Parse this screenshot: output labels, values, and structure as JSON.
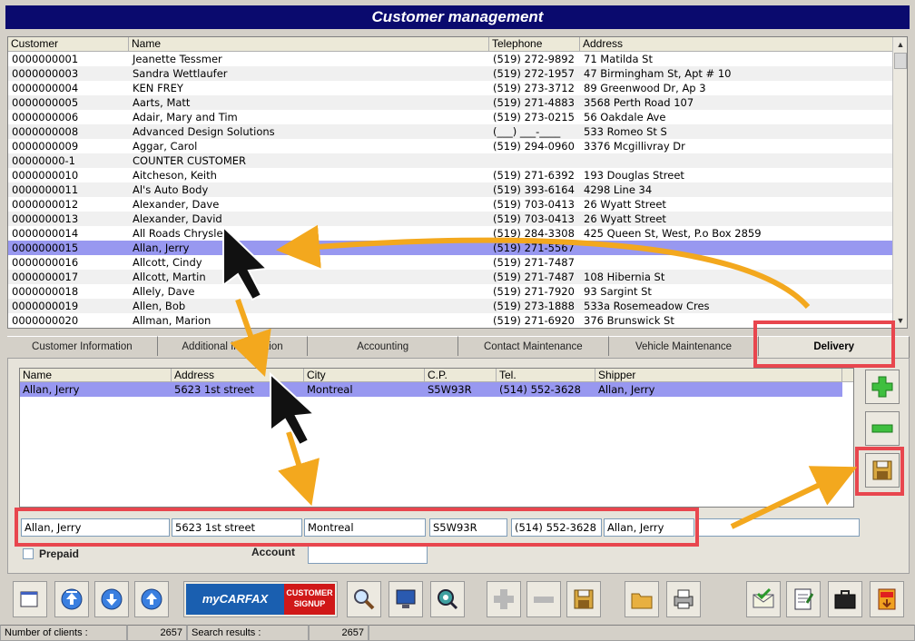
{
  "window": {
    "title": "Customer management"
  },
  "grid": {
    "headers": [
      "Customer",
      "Name",
      "Telephone",
      "Address"
    ],
    "rows": [
      [
        "0000000001",
        "Jeanette Tessmer",
        "(519) 272-9892",
        "71 Matilda St"
      ],
      [
        "0000000003",
        "Sandra Wettlaufer",
        "(519) 272-1957",
        "47 Birmingham St, Apt # 10"
      ],
      [
        "0000000004",
        " KEN FREY",
        "(519) 273-3712",
        "89 Greenwood Dr, Ap 3"
      ],
      [
        "0000000005",
        "Aarts, Matt",
        "(519) 271-4883",
        "3568 Perth Road 107"
      ],
      [
        "0000000006",
        "Adair, Mary and Tim",
        "(519) 273-0215",
        "56 Oakdale Ave"
      ],
      [
        "0000000008",
        "Advanced Design Solutions",
        "(___) ___-____",
        "533 Romeo St S"
      ],
      [
        "0000000009",
        "Aggar, Carol",
        "(519) 294-0960",
        "3376 Mcgillivray Dr"
      ],
      [
        "00000000-1",
        "COUNTER CUSTOMER",
        "",
        ""
      ],
      [
        "0000000010",
        "Aitcheson, Keith",
        "(519) 271-6392",
        "193 Douglas Street"
      ],
      [
        "0000000011",
        "Al's Auto Body",
        "(519) 393-6164",
        "4298 Line 34"
      ],
      [
        "0000000012",
        "Alexander, Dave",
        "(519) 703-0413",
        "26 Wyatt Street"
      ],
      [
        "0000000013",
        "Alexander, David",
        "(519) 703-0413",
        "26 Wyatt Street"
      ],
      [
        "0000000014",
        "All Roads Chrysler",
        "(519) 284-3308",
        "425 Queen St, West, P.o Box 2859"
      ],
      [
        "0000000015",
        "Allan, Jerry",
        "(519) 271-5567",
        ""
      ],
      [
        "0000000016",
        "Allcott, Cindy",
        "(519) 271-7487",
        ""
      ],
      [
        "0000000017",
        "Allcott, Martin",
        "(519) 271-7487",
        "108 Hibernia St"
      ],
      [
        "0000000018",
        "Allely, Dave",
        "(519) 271-7920",
        "93 Sargint St"
      ],
      [
        "0000000019",
        "Allen, Bob",
        "(519) 273-1888",
        "533a Rosemeadow Cres"
      ],
      [
        "0000000020",
        "Allman, Marion",
        "(519) 271-6920",
        "376 Brunswick St"
      ]
    ],
    "selected_index": 13
  },
  "tabs": [
    "Customer Information",
    "Additional Information",
    "Accounting",
    "Contact Maintenance",
    "Vehicle Maintenance",
    "Delivery"
  ],
  "active_tab": "Delivery",
  "delivery": {
    "headers": [
      "Name",
      "Address",
      "City",
      "C.P.",
      "Tel.",
      "Shipper"
    ],
    "row": [
      "Allan, Jerry",
      "5623 1st street",
      "Montreal",
      "S5W93R",
      "(514) 552-3628",
      "Allan, Jerry"
    ],
    "fields": {
      "name": "Allan, Jerry",
      "address": "5623 1st street",
      "city": "Montreal",
      "cp": "S5W93R",
      "tel": "(514) 552-3628",
      "shipper": "Allan, Jerry",
      "extra": ""
    },
    "prepaid_label": "Prepaid",
    "prepaid_checked": false,
    "account_label": "Account",
    "account_value": ""
  },
  "toolbar": {
    "carfax_left": "myCARFAX",
    "carfax_right": "CUSTOMER SIGNUP"
  },
  "status": {
    "clients_label": "Number of clients :",
    "clients_value": "2657",
    "search_label": "Search results :",
    "search_value": "2657"
  },
  "colors": {
    "title_bg": "#0a0a6e",
    "selection": "#9898f0",
    "highlight_box": "#e8464e",
    "arrow": "#f3a81e"
  }
}
